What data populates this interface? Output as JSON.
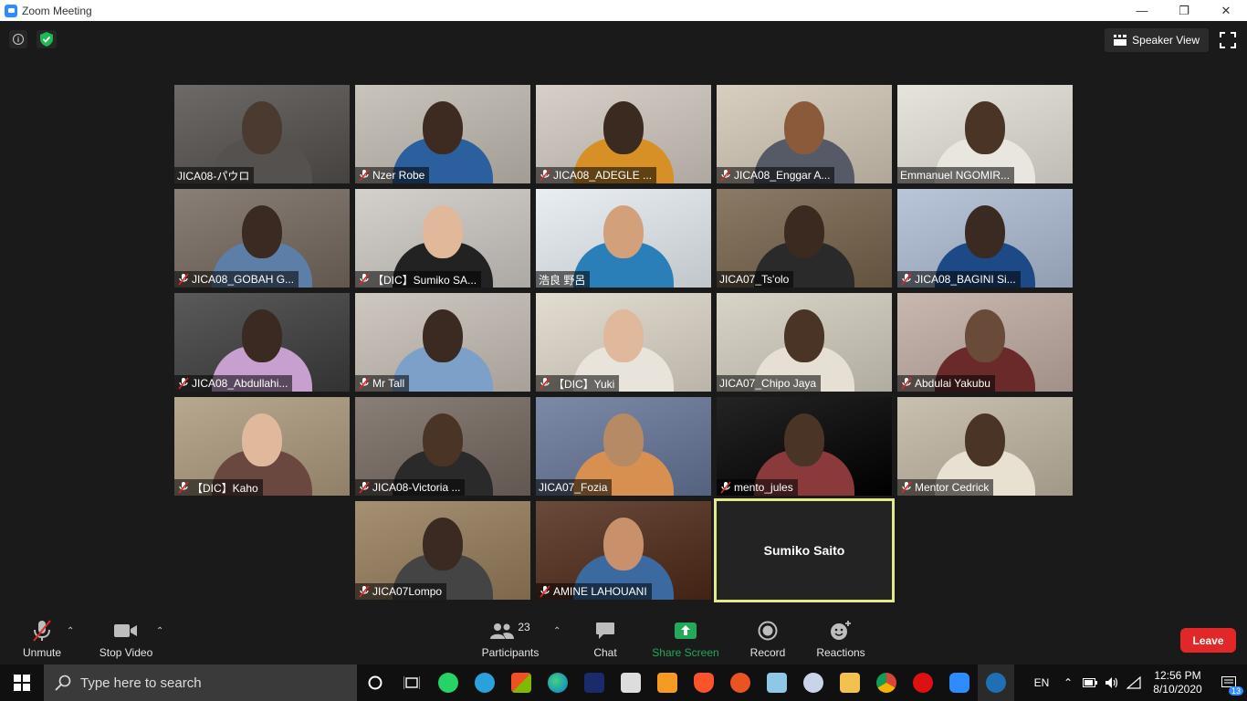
{
  "window": {
    "title": "Zoom Meeting",
    "minimize": "—",
    "restore": "❐",
    "close": "✕"
  },
  "top_bar": {
    "speaker_view_label": "Speaker View"
  },
  "participants": [
    {
      "name": "JICA08-パウロ",
      "muted": false
    },
    {
      "name": "Nzer Robe",
      "muted": true
    },
    {
      "name": "JICA08_ADEGLE ...",
      "muted": true
    },
    {
      "name": "JICA08_Enggar A...",
      "muted": true
    },
    {
      "name": "Emmanuel NGOMIR...",
      "muted": false
    },
    {
      "name": "JICA08_GOBAH G...",
      "muted": true
    },
    {
      "name": "【DIC】Sumiko SA...",
      "muted": true
    },
    {
      "name": "浩良 野呂",
      "muted": false
    },
    {
      "name": "JICA07_Ts'olo",
      "muted": false
    },
    {
      "name": "JICA08_BAGINI Si...",
      "muted": true
    },
    {
      "name": "JICA08_Abdullahi...",
      "muted": true
    },
    {
      "name": "Mr Tall",
      "muted": true
    },
    {
      "name": "【DIC】Yuki",
      "muted": true
    },
    {
      "name": "JICA07_Chipo Jaya",
      "muted": false
    },
    {
      "name": "Abdulai Yakubu",
      "muted": true
    },
    {
      "name": "【DIC】Kaho",
      "muted": true
    },
    {
      "name": "JICA08-Victoria ...",
      "muted": true
    },
    {
      "name": "JICA07_Fozia",
      "muted": false
    },
    {
      "name": "mento_jules",
      "muted": true
    },
    {
      "name": "Mentor Cedrick",
      "muted": true
    },
    {
      "name": "JICA07Lompo",
      "muted": true
    },
    {
      "name": "AMINE LAHOUANI",
      "muted": true
    }
  ],
  "self_tile": {
    "name": "Sumiko Saito"
  },
  "toolbar": {
    "unmute_label": "Unmute",
    "stop_video_label": "Stop Video",
    "participants_label": "Participants",
    "participants_count": "23",
    "chat_label": "Chat",
    "share_screen_label": "Share Screen",
    "record_label": "Record",
    "reactions_label": "Reactions",
    "leave_label": "Leave"
  },
  "taskbar": {
    "search_placeholder": "Type here to search",
    "language": "EN",
    "time": "12:56 PM",
    "date": "8/10/2020",
    "notifications_count": "13"
  },
  "colors": {
    "accent_green": "#1db954",
    "share_screen_green": "#23a95a",
    "leave_red": "#e02828",
    "active_speaker_border": "#e3ea8c",
    "zoom_blue": "#2d8cff"
  }
}
